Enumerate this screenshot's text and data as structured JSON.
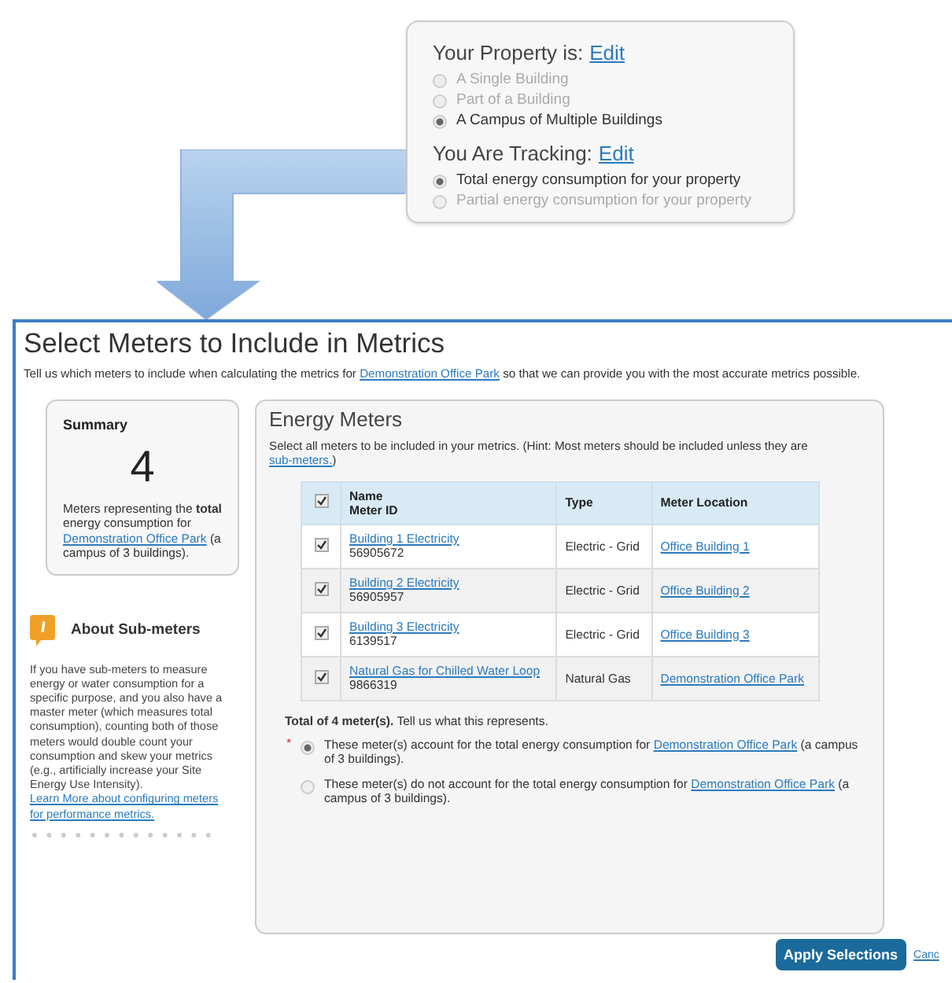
{
  "property_card": {
    "property_heading": "Your Property is:",
    "property_edit": "Edit",
    "property_options": [
      {
        "label": "A Single Building",
        "selected": false
      },
      {
        "label": "Part of a Building",
        "selected": false
      },
      {
        "label": "A Campus of Multiple Buildings",
        "selected": true
      }
    ],
    "tracking_heading": "You Are Tracking:",
    "tracking_edit": "Edit",
    "tracking_options": [
      {
        "label": "Total energy consumption for your property",
        "selected": true
      },
      {
        "label": "Partial energy consumption for your property",
        "selected": false
      }
    ]
  },
  "page": {
    "title": "Select Meters to Include in Metrics",
    "intro": {
      "before": "Tell us which meters to include when calculating the metrics for ",
      "link": "Demonstration Office Park",
      "after": " so that we can provide you with the most accurate metrics possible."
    }
  },
  "summary": {
    "title": "Summary",
    "count": "4",
    "text": {
      "before": "Meters representing the **total** energy consumption for ",
      "link": "Demonstration Office Park",
      "after": " (a campus of 3 buildings)."
    }
  },
  "about": {
    "title": "About Sub-meters",
    "text": "If you have sub-meters to measure energy or water consumption for a specific purpose, and you also have a master meter (which measures total consumption), counting both of those meters would double count your consumption and skew your metrics (e.g., artificially increase your Site Energy Use Intensity).",
    "link": "Learn More about configuring meters for performance metrics."
  },
  "energy_meters": {
    "title": "Energy Meters",
    "hint": {
      "before": "Select all meters to be included in your metrics. (Hint: Most meters should be included unless they are ",
      "link": "sub-meters.",
      "after": ")"
    },
    "table": {
      "all_checked": true,
      "name_header": "Name",
      "id_header": "Meter ID",
      "type_header": "Type",
      "location_header": "Meter Location",
      "rows": [
        {
          "checked": true,
          "name": "Building 1 Electricity",
          "meter_id": "56905672",
          "type": "Electric - Grid",
          "location": "Office Building 1"
        },
        {
          "checked": true,
          "name": "Building 2 Electricity",
          "meter_id": "56905957",
          "type": "Electric - Grid",
          "location": "Office Building 2"
        },
        {
          "checked": true,
          "name": "Building 3 Electricity",
          "meter_id": "6139517",
          "type": "Electric - Grid",
          "location": "Office Building 3"
        },
        {
          "checked": true,
          "name": "Natural Gas for Chilled Water Loop",
          "meter_id": "9866319",
          "type": "Natural Gas",
          "location": "Demonstration Office Park"
        }
      ]
    },
    "total": "**Total of 4 meter(s).** Tell us what this represents.",
    "required_mark": "*",
    "options": [
      {
        "selected": true,
        "before": "These meter(s) account for the total energy consumption for ",
        "link": "Demonstration Office Park",
        "after": " (a campus of 3 buildings)."
      },
      {
        "selected": false,
        "before": "These meter(s) do not account for the total energy consumption for ",
        "link": "Demonstration Office Park",
        "after": " (a campus of 3 buildings)."
      }
    ]
  },
  "actions": {
    "apply": "Apply Selections",
    "cancel": "Canc"
  }
}
